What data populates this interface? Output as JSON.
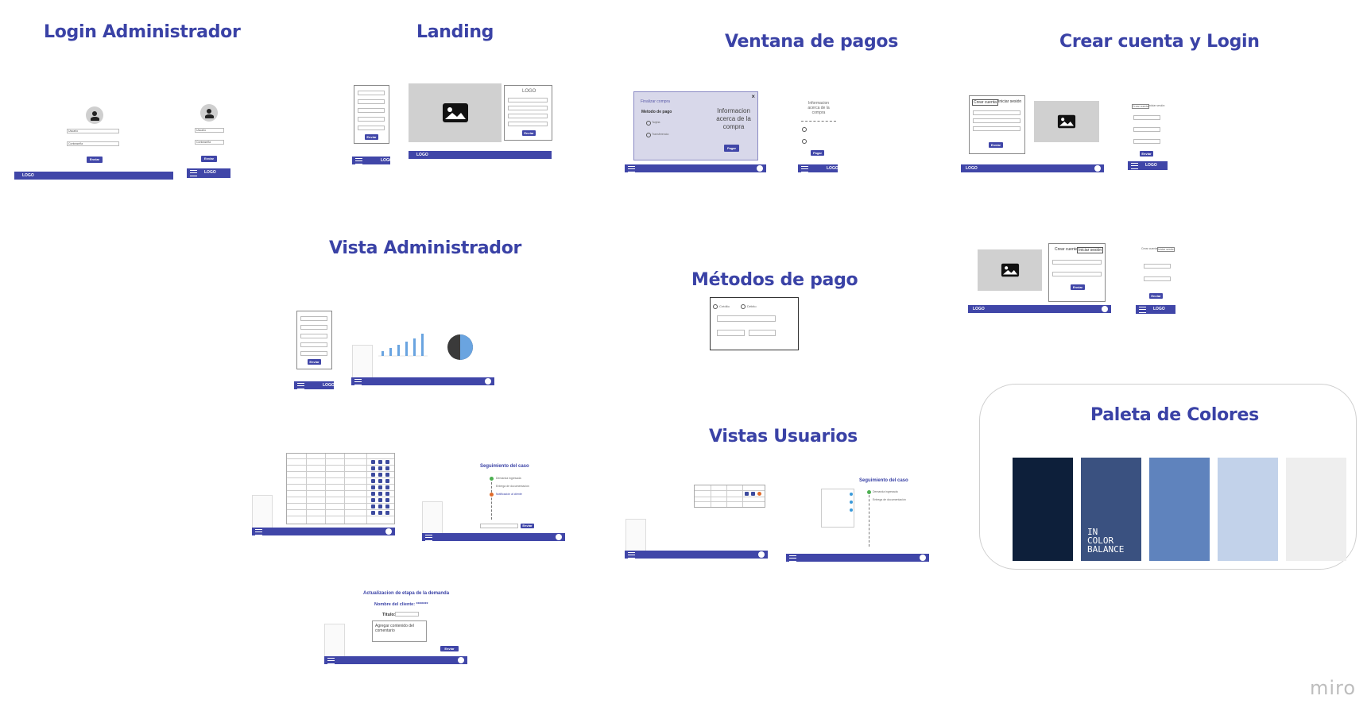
{
  "sections": {
    "login_admin": "Login Administrador",
    "landing": "Landing",
    "ventana_pagos": "Ventana de pagos",
    "crear_cuenta": "Crear cuenta y Login",
    "vista_admin": "Vista Administrador",
    "metodos_pago": "Métodos de pago",
    "vistas_usuarios": "Vistas Usuarios",
    "paleta": "Paleta de Colores"
  },
  "common": {
    "logo": "LOGO",
    "enviar": "Enviar",
    "pagar": "Pagar"
  },
  "login_admin": {
    "usuario": "Usuario",
    "password": "Contraseña"
  },
  "ventana_pagos": {
    "finalizar": "Finalizar compra",
    "metodo": "Metodo de pago",
    "info": "Informacion acerca de la compra",
    "opt1": "Tarjeta",
    "opt2": "Transferencia",
    "mobile_info": "Informacion acerca de la compra"
  },
  "crear_cuenta": {
    "tab_crear": "Crear cuenta",
    "tab_iniciar": "Iniciar sesión"
  },
  "metodos_pago": {
    "opt_credito": "Crédito",
    "opt_debito": "Débito"
  },
  "seguimiento": {
    "title": "Seguimiento del caso",
    "step1": "Demanda ingresada",
    "step2": "Entrega de documentación",
    "step3": "Notificación al cliente"
  },
  "actualizacion": {
    "title": "Actualizacion de etapa de la demanda",
    "cliente": "Nombre del cliente: *******",
    "titulo_label": "Titulo:",
    "contenido": "Agregar contenido del comentario"
  },
  "paleta": {
    "watermark": "IN\nCOLOR\nBALANCE",
    "colors": [
      "#0d1f3a",
      "#3a5180",
      "#5f83bd",
      "#c2d2ea",
      "#eeeeee"
    ]
  },
  "miro_logo": "miro"
}
